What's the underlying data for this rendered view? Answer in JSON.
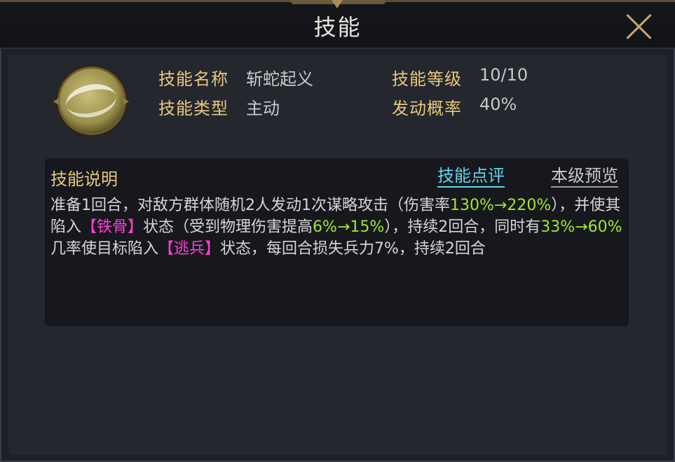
{
  "window": {
    "title": "技能"
  },
  "skill": {
    "icon": "swirl-skill-icon",
    "name_label": "技能名称",
    "name_value": "斩蛇起义",
    "level_label": "技能等级",
    "level_value": "10/10",
    "type_label": "技能类型",
    "type_value": "主动",
    "chance_label": "发动概率",
    "chance_value": "40%"
  },
  "description": {
    "title": "技能说明",
    "review_link": "技能点评",
    "preview_link": "本级预览",
    "segments": [
      {
        "text": "准备1回合，对敌方群体随机2人发动1次谋略攻击（伤害率",
        "style": "normal"
      },
      {
        "text": "130%→220%",
        "style": "green"
      },
      {
        "text": "），并使其陷入",
        "style": "normal"
      },
      {
        "text": "【铁骨】",
        "style": "pink"
      },
      {
        "text": "状态（受到物理伤害提高",
        "style": "normal"
      },
      {
        "text": "6%→15%",
        "style": "green"
      },
      {
        "text": "），持续2回合，同时有",
        "style": "normal"
      },
      {
        "text": "33%→60%",
        "style": "green"
      },
      {
        "text": "几率使目标陷入",
        "style": "normal"
      },
      {
        "text": "【逃兵】",
        "style": "pink"
      },
      {
        "text": "状态，每回合损失兵力7%，持续2回合",
        "style": "normal"
      }
    ]
  },
  "colors": {
    "label_gold": "#e8c77c",
    "highlight_green": "#9ee82c",
    "highlight_pink": "#ff3fd4",
    "link_cyan": "#5fd6ea"
  }
}
